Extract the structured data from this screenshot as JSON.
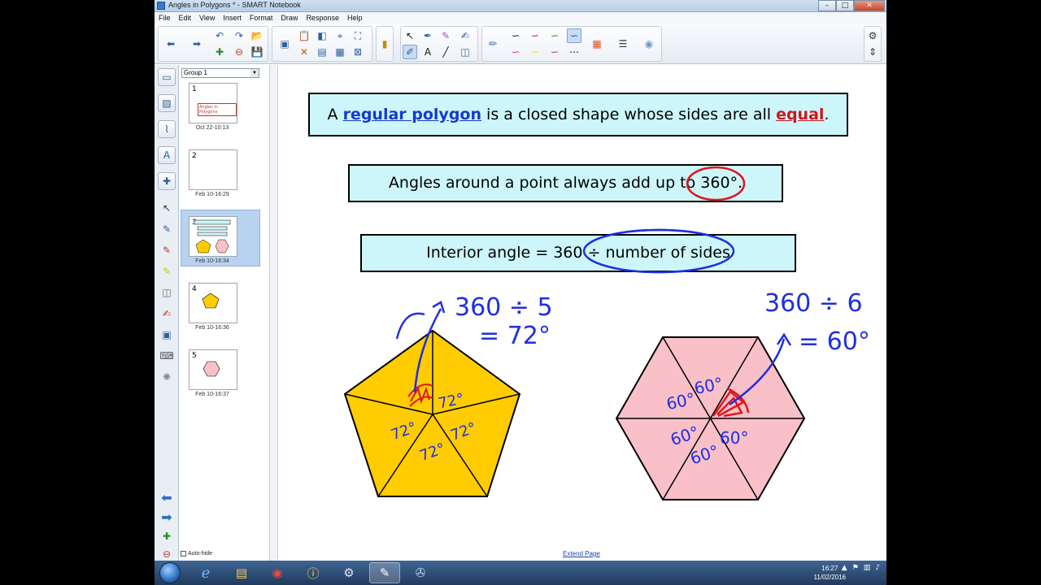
{
  "window": {
    "title": "Angles in Polygons * - SMART Notebook",
    "min": "–",
    "max": "□",
    "close": "✕"
  },
  "menu": [
    "File",
    "Edit",
    "View",
    "Insert",
    "Format",
    "Draw",
    "Response",
    "Help"
  ],
  "sorter": {
    "group": "Group 1",
    "autohide": "Auto-hide",
    "pages": [
      {
        "num": "1",
        "caption": "Oct 22-10:13",
        "thumb_text": "Angles in Polygons"
      },
      {
        "num": "2",
        "caption": "Feb 10-16:29"
      },
      {
        "num": "3",
        "caption": "Feb 10-16:34"
      },
      {
        "num": "4",
        "caption": "Feb 10-16:36"
      },
      {
        "num": "5",
        "caption": "Feb 10-16:37"
      }
    ]
  },
  "canvas": {
    "box1": {
      "prefix": "A ",
      "kw1": "regular polygon",
      "mid": " is a closed shape whose sides are all ",
      "kw2": "equal",
      "suffix": "."
    },
    "box2": "Angles around a point always add up to 360°.",
    "box3": "Interior angle = 360 ÷ number of sides",
    "pentagon_ink": {
      "calc1": "360 ÷ 5",
      "calc2": "= 72°",
      "angle": "72°"
    },
    "hexagon_ink": {
      "calc1": "360 ÷ 6",
      "calc2": "= 60°",
      "angle": "60°"
    },
    "extend": "Extend Page"
  },
  "colors": {
    "pentagon_fill": "#ffcc00",
    "hexagon_fill": "#f9c0c8",
    "ink_blue": "#1f2fe0",
    "ink_red": "#e0161c",
    "box_fill": "#ccf6fa"
  },
  "taskbar": {
    "time": "16:27",
    "date": "11/02/2016"
  }
}
